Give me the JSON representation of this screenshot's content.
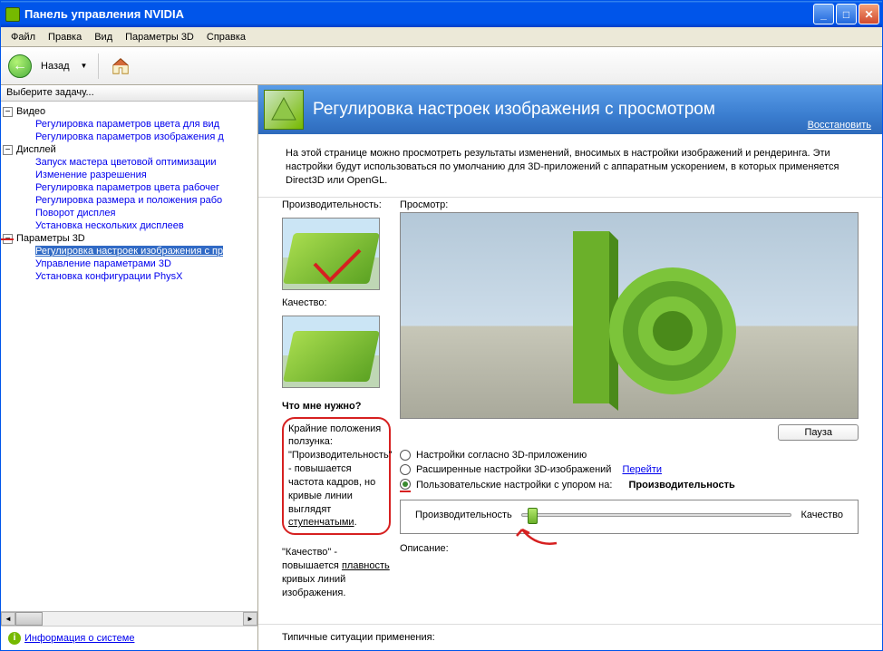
{
  "window": {
    "title": "Панель управления NVIDIA"
  },
  "menu": {
    "file": "Файл",
    "edit": "Правка",
    "view": "Вид",
    "params3d": "Параметры 3D",
    "help": "Справка"
  },
  "toolbar": {
    "back": "Назад"
  },
  "sidebar": {
    "task_label": "Выберите задачу...",
    "sys_info": "Информация о системе",
    "tree": {
      "video": "Видео",
      "video_items": [
        "Регулировка параметров цвета для вид",
        "Регулировка параметров изображения д"
      ],
      "display": "Дисплей",
      "display_items": [
        "Запуск мастера цветовой оптимизации",
        "Изменение разрешения",
        "Регулировка параметров цвета рабочег",
        "Регулировка размера и положения рабо",
        "Поворот дисплея",
        "Установка нескольких дисплеев"
      ],
      "params3d": "Параметры 3D",
      "params3d_items": [
        "Регулировка настроек изображения с пр",
        "Управление параметрами 3D",
        "Установка конфигурации PhysX"
      ]
    }
  },
  "banner": {
    "title": "Регулировка настроек изображения с просмотром",
    "restore": "Восстановить"
  },
  "content": {
    "description": "На этой странице можно просмотреть результаты изменений, вносимых в настройки изображений и рендеринга. Эти настройки будут использоваться по умолчанию для 3D-приложений с аппаратным ускорением, в которых применяется Direct3D или OpenGL.",
    "perf_label": "Производительность:",
    "quality_label": "Качество:",
    "preview_label": "Просмотр:",
    "help_hdr": "Что мне нужно?",
    "help1a": "Крайние положения ползунка:",
    "help1b": "\"Производительность\" - повышается частота кадров, но кривые линии выглядят ",
    "help1c": "ступенчатыми",
    "help2a": "\"Качество\" - повышается ",
    "help2b": "плавность",
    "help2c": " кривых линий изображения.",
    "pause": "Пауза",
    "radio1": "Настройки согласно 3D-приложению",
    "radio2": "Расширенные настройки 3D-изображений",
    "radio2_link": "Перейти",
    "radio3": "Пользовательские настройки с упором на:",
    "radio3_val": "Производительность",
    "slider_left": "Производительность",
    "slider_right": "Качество",
    "desc_label": "Описание:",
    "typical": "Типичные ситуации применения:"
  }
}
